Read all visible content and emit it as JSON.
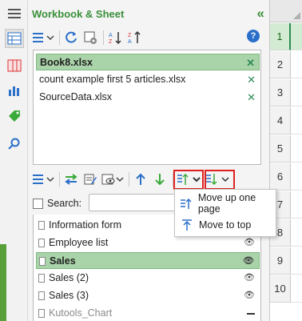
{
  "panel": {
    "title": "Workbook & Sheet",
    "collapse_icon": "double-chevron-left-icon"
  },
  "workbooks": [
    {
      "name": "Book8.xlsx",
      "selected": true
    },
    {
      "name": "count example first 5 articles.xlsx",
      "selected": false
    },
    {
      "name": "SourceData.xlsx",
      "selected": false
    }
  ],
  "search": {
    "label": "Search:",
    "value": ""
  },
  "sheets": [
    {
      "name": "Information form",
      "visible": true,
      "selected": false
    },
    {
      "name": "Employee list",
      "visible": true,
      "selected": false
    },
    {
      "name": "Sales",
      "visible": true,
      "selected": true
    },
    {
      "name": "Sales (2)",
      "visible": true,
      "selected": false
    },
    {
      "name": "Sales (3)",
      "visible": true,
      "selected": false
    },
    {
      "name": "Kutools_Chart",
      "visible": false,
      "selected": false
    }
  ],
  "menu": {
    "items": [
      {
        "label": "Move up one page"
      },
      {
        "label": "Move to top"
      }
    ]
  },
  "rows": [
    "1",
    "2",
    "3",
    "4",
    "5",
    "6",
    "7",
    "8",
    "9",
    "10"
  ],
  "colors": {
    "accent": "#3a8f3a",
    "selection": "#a9d3a9",
    "highlight_box": "#e02020"
  }
}
